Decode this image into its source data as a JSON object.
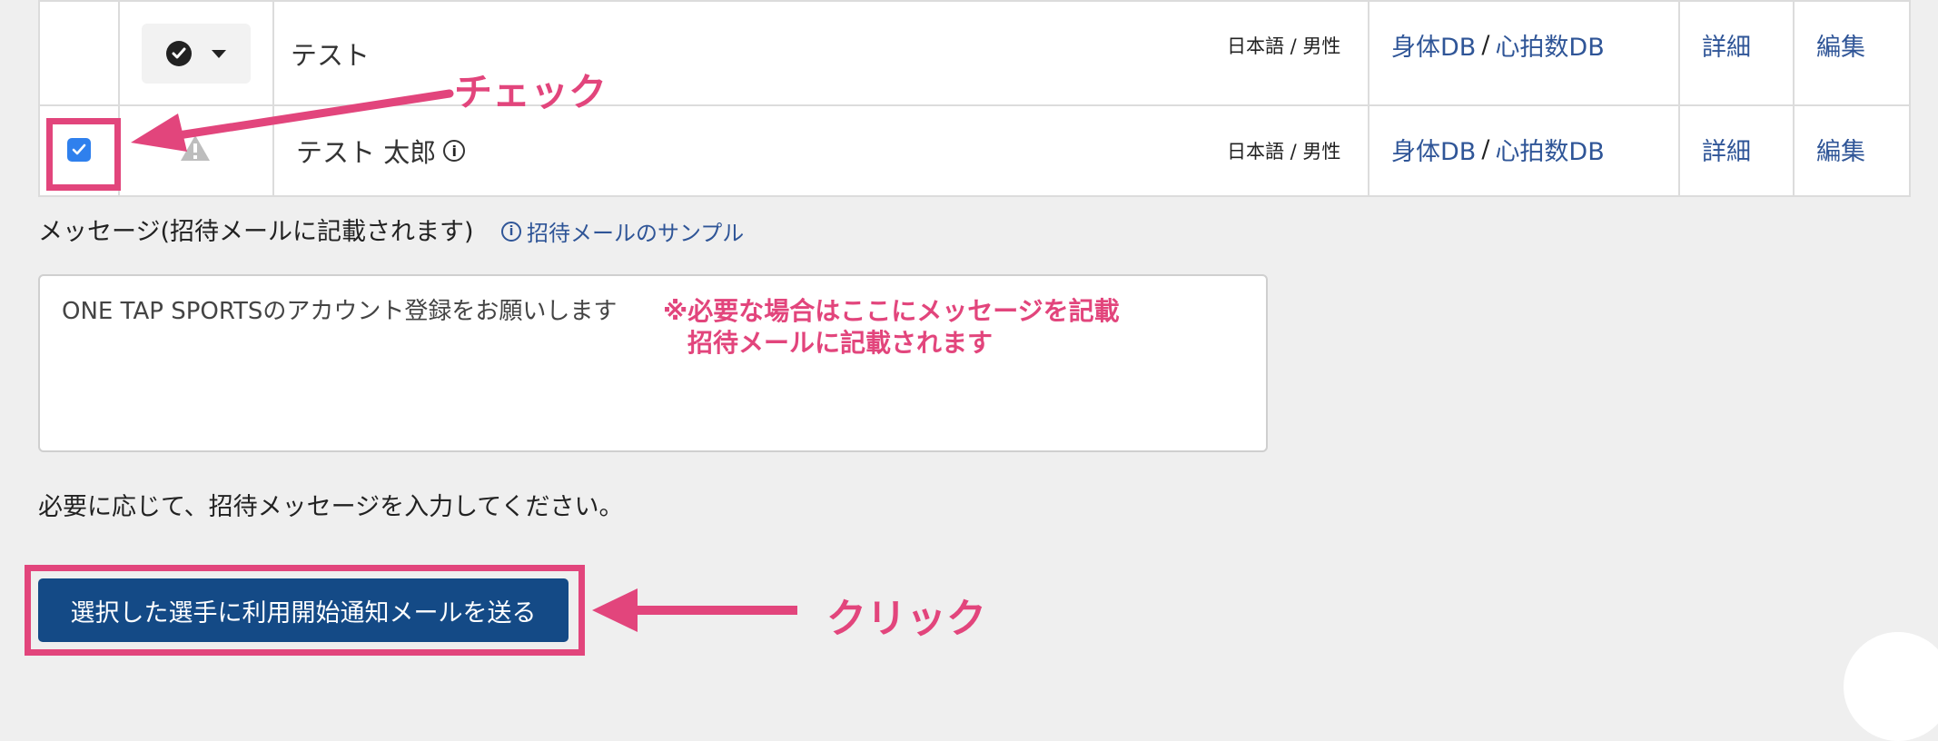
{
  "table": {
    "rows": [
      {
        "name": "テスト",
        "lang_gender": "日本語 / 男性",
        "link_body": "身体DB",
        "separator": "/",
        "link_heart": "心拍数DB",
        "detail": "詳細",
        "edit": "編集"
      },
      {
        "name": "テスト 太郎",
        "info_glyph": "i",
        "lang_gender": "日本語 / 男性",
        "link_body": "身体DB",
        "separator": "/",
        "link_heart": "心拍数DB",
        "detail": "詳細",
        "edit": "編集"
      }
    ]
  },
  "message": {
    "label": "メッセージ(招待メールに記載されます)",
    "sample_link": "招待メールのサンプル",
    "textarea_value": "ONE TAP SPORTSのアカウント登録をお願いします",
    "helper": "必要に応じて、招待メッセージを入力してください。"
  },
  "send_button_label": "選択した選手に利用開始通知メールを送る",
  "annotations": {
    "check": "チェック",
    "click": "クリック",
    "note_line1": "※必要な場合はここにメッセージを記載",
    "note_line2": "招待メールに記載されます",
    "color": "#e2457c"
  },
  "colors": {
    "link": "#2f5597",
    "button": "#144a86",
    "checkbox": "#2f80ed",
    "background": "#efefef"
  }
}
